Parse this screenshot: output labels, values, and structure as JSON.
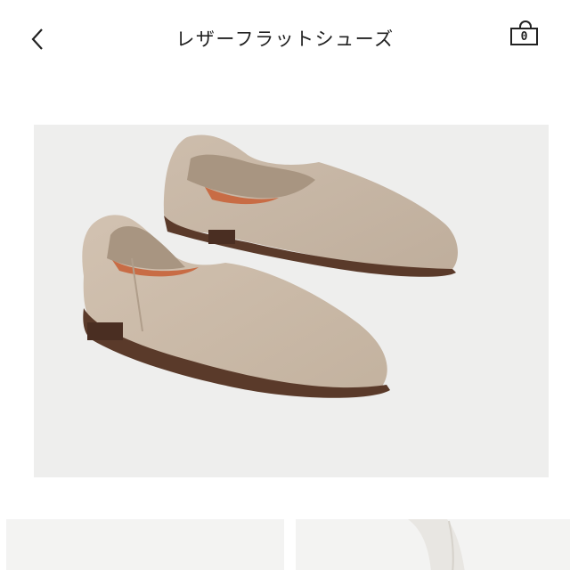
{
  "header": {
    "title": "レザーフラットシューズ",
    "back_icon": "chevron-left-icon",
    "cart_icon": "shopping-bag-icon",
    "cart_count": "0"
  },
  "product": {
    "main_image": "suede-flat-shoes-photo",
    "thumbnails": [
      "product-thumbnail",
      "product-thumbnail"
    ]
  },
  "colors": {
    "text": "#222222",
    "image_bg": "#eeeeed",
    "suede": "#c9b8a6",
    "sole": "#5a3a2a",
    "lining": "#c86c45"
  }
}
